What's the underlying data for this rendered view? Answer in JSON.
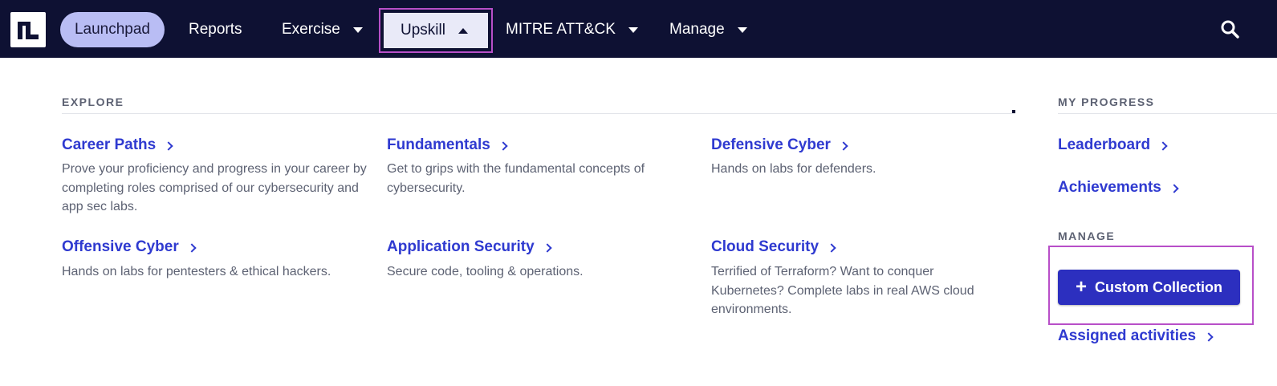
{
  "nav": {
    "launchpad": "Launchpad",
    "reports": "Reports",
    "exercise": "Exercise",
    "upskill": "Upskill",
    "mitre": "MITRE ATT&CK",
    "manage": "Manage"
  },
  "explore": {
    "heading": "EXPLORE",
    "items": [
      {
        "title": "Career Paths",
        "desc": "Prove your proficiency and progress in your career by completing roles comprised of our cybersecurity and app sec labs."
      },
      {
        "title": "Fundamentals",
        "desc": "Get to grips with the fundamental concepts of cybersecurity."
      },
      {
        "title": "Defensive Cyber",
        "desc": "Hands on labs for defenders."
      },
      {
        "title": "Offensive Cyber",
        "desc": "Hands on labs for pentesters & ethical hackers."
      },
      {
        "title": "Application Security",
        "desc": "Secure code, tooling & operations."
      },
      {
        "title": "Cloud Security",
        "desc": "Terrified of Terraform? Want to conquer Kubernetes? Complete labs in real AWS cloud environments."
      }
    ]
  },
  "progress": {
    "heading": "MY PROGRESS",
    "leaderboard": "Leaderboard",
    "achievements": "Achievements"
  },
  "manage": {
    "heading": "MANAGE",
    "custom_collection": "Custom Collection",
    "assigned": "Assigned activities"
  },
  "colors": {
    "topbar": "#0e1133",
    "accent": "#2f3ad0",
    "highlight": "#b84fc8",
    "launchpad_pill": "#b9bdf4"
  }
}
